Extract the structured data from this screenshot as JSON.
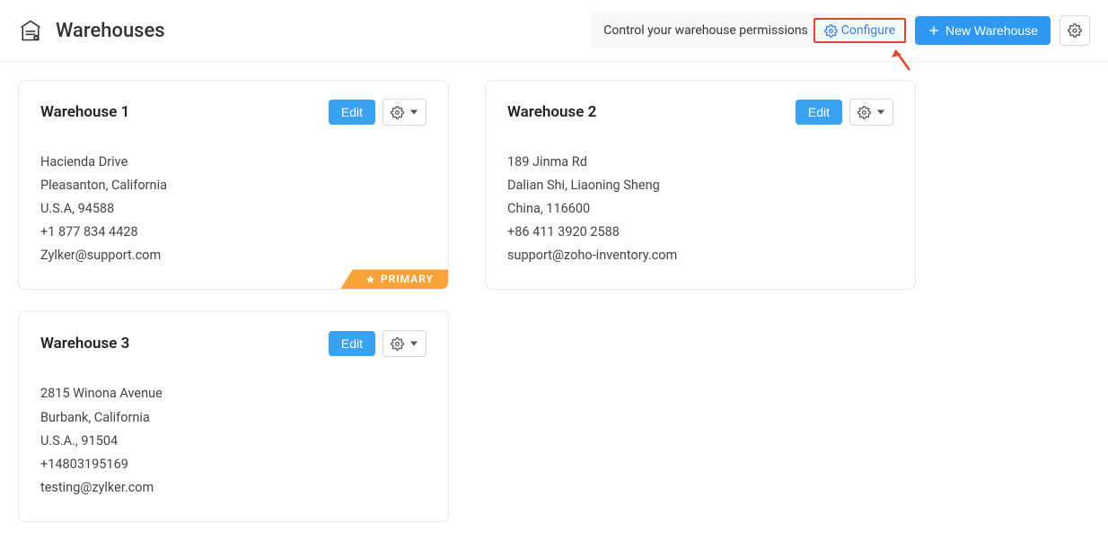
{
  "header": {
    "title": "Warehouses",
    "permission_text": "Control your warehouse permissions",
    "configure_label": "Configure",
    "new_warehouse_label": "New Warehouse"
  },
  "buttons": {
    "edit_label": "Edit"
  },
  "badges": {
    "primary_label": "PRIMARY"
  },
  "warehouses": [
    {
      "name": "Warehouse 1",
      "street": "Hacienda Drive",
      "city": "Pleasanton, California",
      "country": "U.S.A, 94588",
      "phone": "+1 877 834 4428",
      "email": "Zylker@support.com",
      "primary": true
    },
    {
      "name": "Warehouse 2",
      "street": "189 Jinma Rd",
      "city": "Dalian Shi, Liaoning Sheng",
      "country": "China, 116600",
      "phone": "+86 411 3920 2588",
      "email": "support@zoho-inventory.com",
      "primary": false
    },
    {
      "name": "Warehouse 3",
      "street": "2815 Winona Avenue",
      "city": "Burbank, California",
      "country": "U.S.A., 91504",
      "phone": "+14803195169",
      "email": "testing@zylker.com",
      "primary": false
    }
  ]
}
